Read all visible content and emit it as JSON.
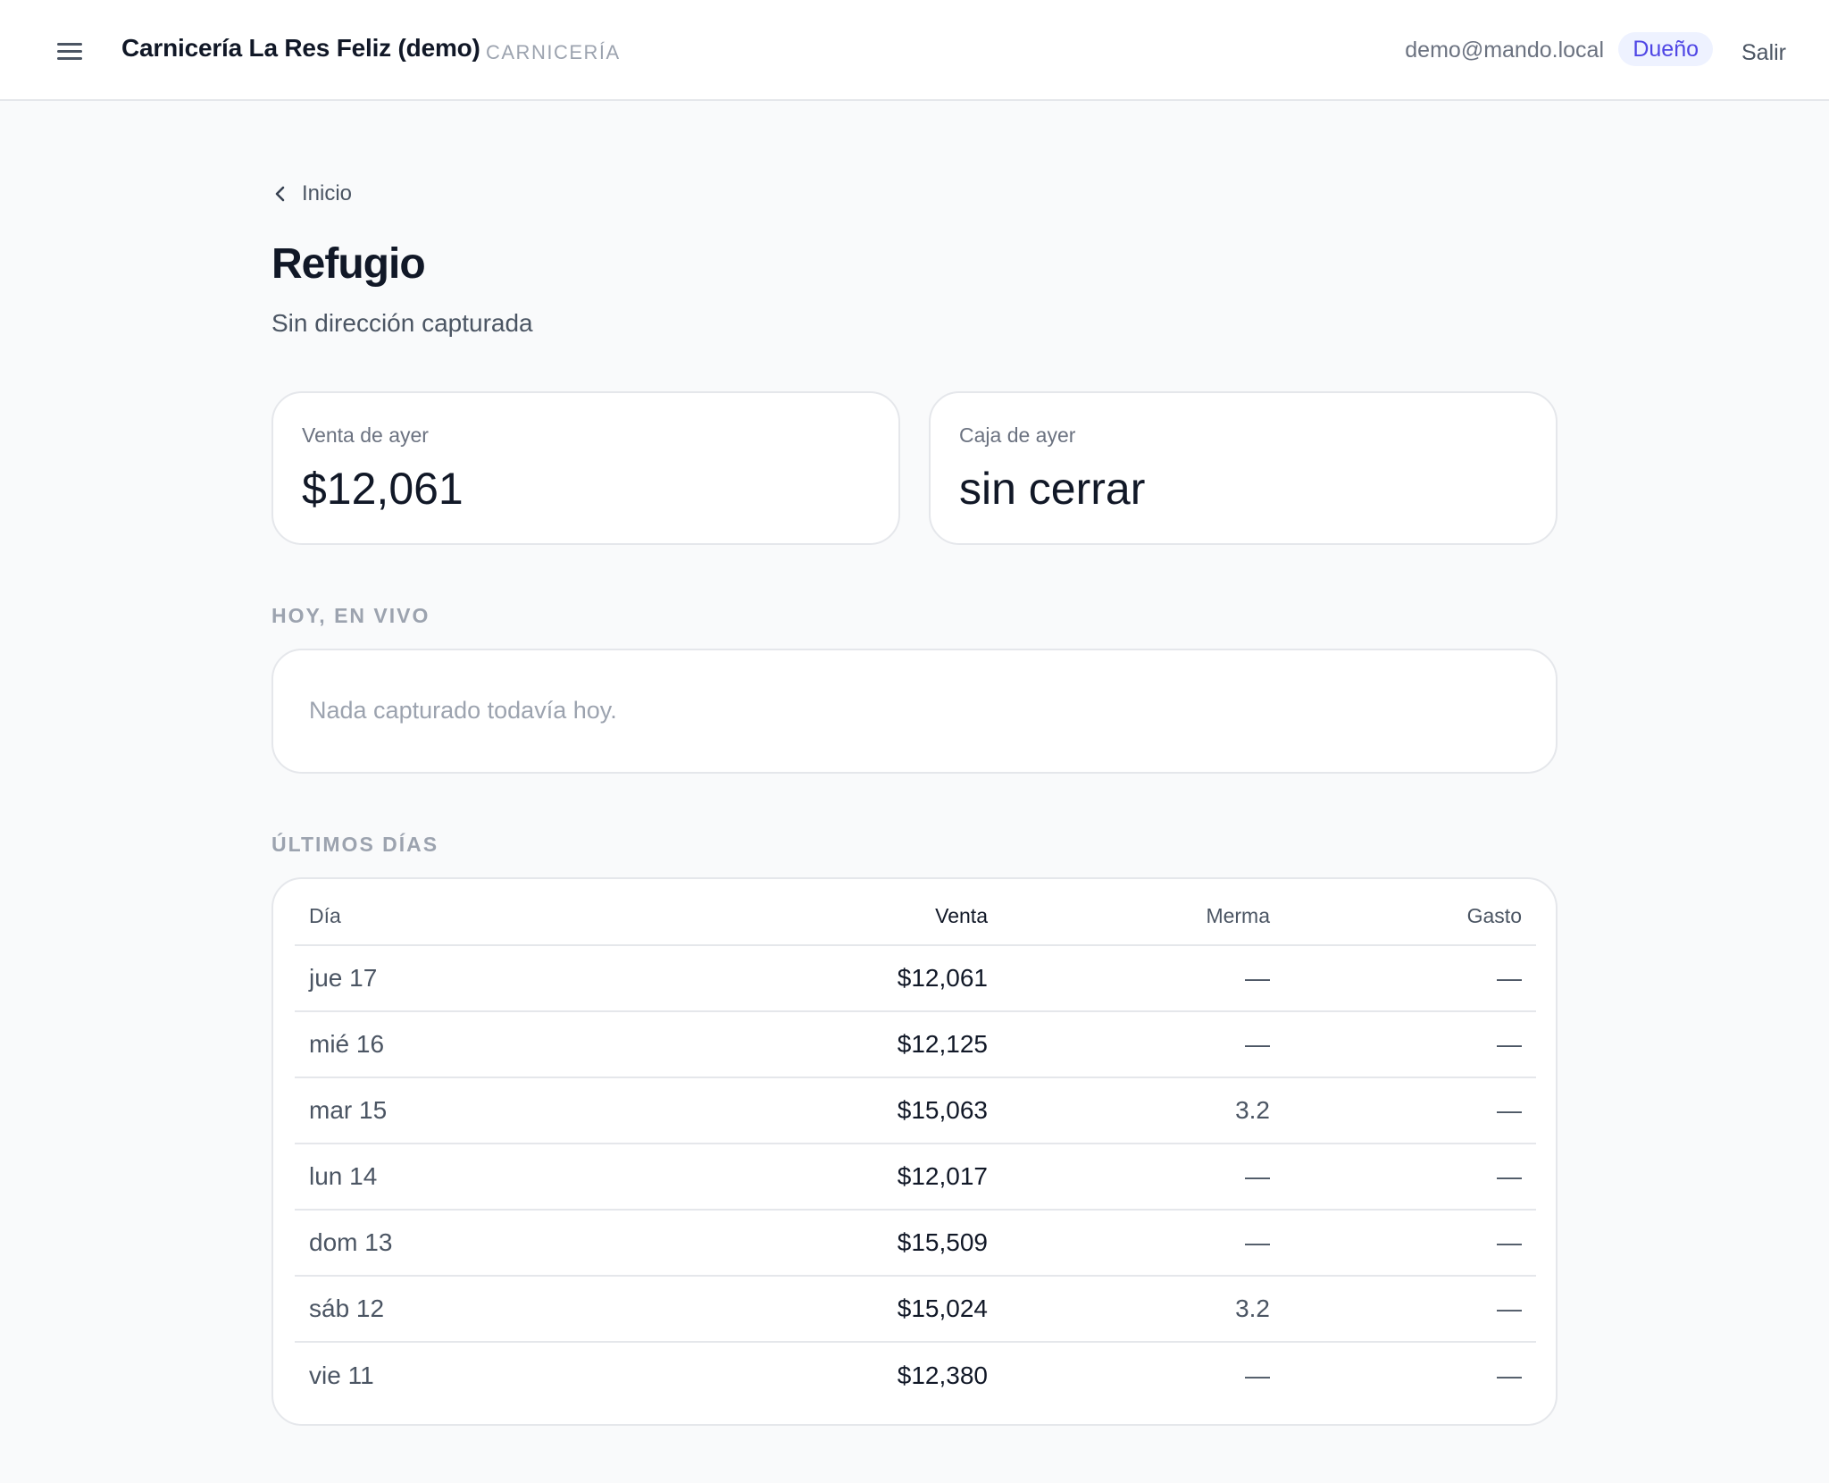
{
  "header": {
    "menu_icon": "hamburger-menu-icon",
    "business_name": "Carnicería La Res Feliz (demo)",
    "business_type": "CARNICERÍA",
    "user_email": "demo@mando.local",
    "role": "Dueño",
    "logout_label": "Salir"
  },
  "nav": {
    "back_icon": "chevron-left-icon",
    "back_label": "Inicio"
  },
  "page": {
    "title": "Refugio",
    "subtitle": "Sin dirección capturada"
  },
  "stats": {
    "sales_yesterday_label": "Venta de ayer",
    "sales_yesterday_value": "$12,061",
    "cash_yesterday_label": "Caja de ayer",
    "cash_yesterday_value": "sin cerrar"
  },
  "live": {
    "section_label": "HOY, EN VIVO",
    "empty_text": "Nada capturado todavía hoy."
  },
  "recent": {
    "section_label": "ÚLTIMOS DÍAS",
    "columns": [
      "Día",
      "Venta",
      "Merma",
      "Gasto"
    ],
    "rows": [
      {
        "dia": "jue 17",
        "venta": "$12,061",
        "merma": "—",
        "gasto": "—"
      },
      {
        "dia": "mié 16",
        "venta": "$12,125",
        "merma": "—",
        "gasto": "—"
      },
      {
        "dia": "mar 15",
        "venta": "$15,063",
        "merma": "3.2",
        "gasto": "—"
      },
      {
        "dia": "lun 14",
        "venta": "$12,017",
        "merma": "—",
        "gasto": "—"
      },
      {
        "dia": "dom 13",
        "venta": "$15,509",
        "merma": "—",
        "gasto": "—"
      },
      {
        "dia": "sáb 12",
        "venta": "$15,024",
        "merma": "3.2",
        "gasto": "—"
      },
      {
        "dia": "vie 11",
        "venta": "$12,380",
        "merma": "—",
        "gasto": "—"
      }
    ]
  },
  "colors": {
    "background": "#f9fafb",
    "card": "#ffffff",
    "border": "#e5e7eb",
    "badge_bg": "#eef2ff",
    "badge_text": "#4f46e5",
    "muted_text": "#9ca3af"
  }
}
